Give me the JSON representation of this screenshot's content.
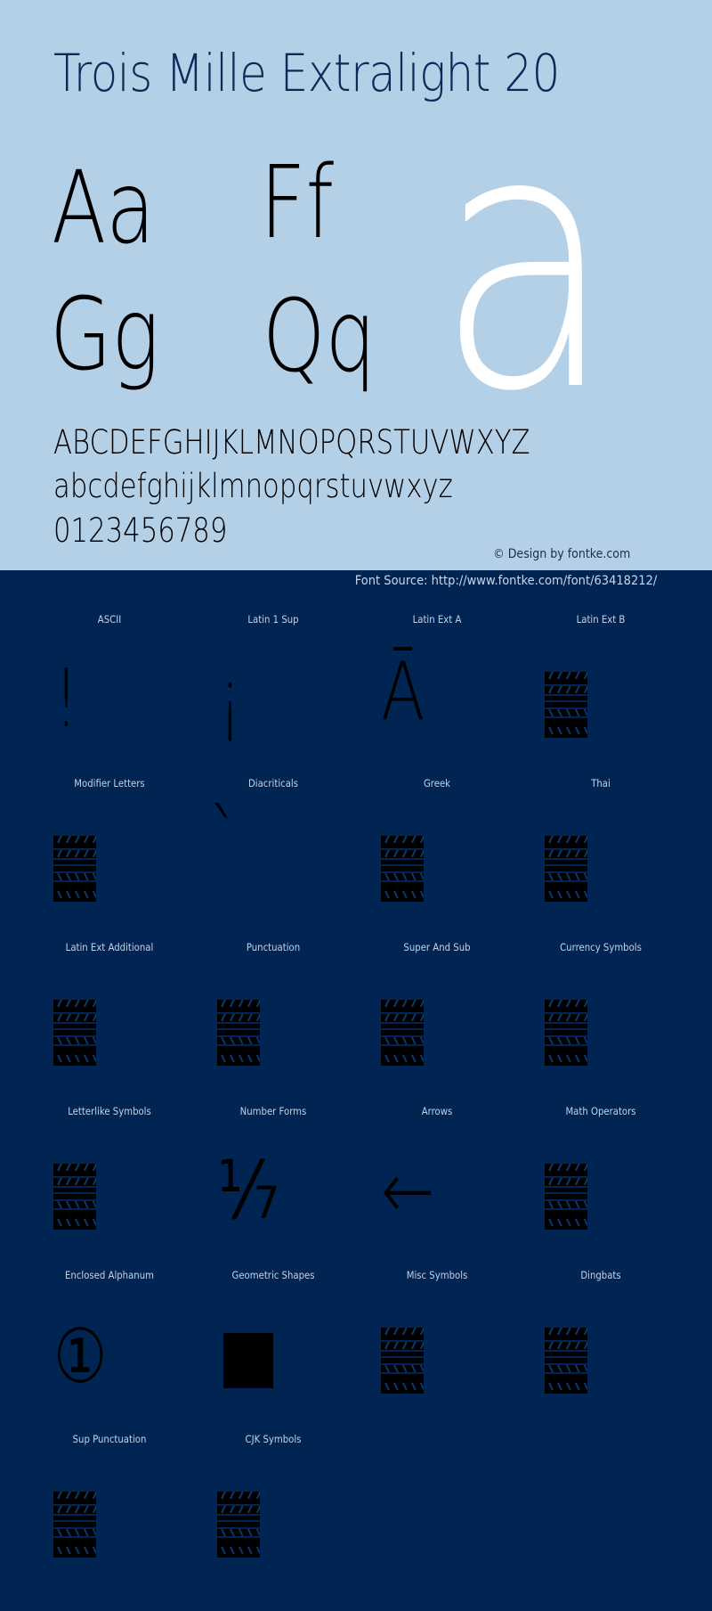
{
  "header": {
    "title": "Trois Mille Extralight 20"
  },
  "specimen": {
    "pairs": [
      "Aa",
      "Ff",
      "Gg",
      "Qq"
    ],
    "big_glyph": "a",
    "uppercase": "ABCDEFGHIJKLMNOPQRSTUVWXYZ",
    "lowercase": "abcdefghijklmnopqrstuvwxyz",
    "digits": "0123456789",
    "credit": "© Design by fontke.com",
    "source": "Font Source: http://www.fontke.com/font/63418212/"
  },
  "colors": {
    "top_background": "#b4d0e7",
    "bottom_background": "#002553",
    "title_color": "#0a2a5a",
    "big_glyph_color": "#ffffff"
  },
  "blocks": [
    {
      "label": "ASCII",
      "glyph": "!",
      "type": "glyph"
    },
    {
      "label": "Latin 1 Sup",
      "glyph": "¡",
      "type": "glyph"
    },
    {
      "label": "Latin Ext A",
      "glyph": "Ā",
      "type": "glyph"
    },
    {
      "label": "Latin Ext B",
      "glyph": "",
      "type": "missing"
    },
    {
      "label": "Modifier Letters",
      "glyph": "",
      "type": "missing"
    },
    {
      "label": "Diacriticals",
      "glyph": "`",
      "type": "glyph"
    },
    {
      "label": "Greek",
      "glyph": "",
      "type": "missing"
    },
    {
      "label": "Thai",
      "glyph": "",
      "type": "missing"
    },
    {
      "label": "Latin Ext Additional",
      "glyph": "",
      "type": "missing"
    },
    {
      "label": "Punctuation",
      "glyph": "",
      "type": "missing"
    },
    {
      "label": "Super And Sub",
      "glyph": "",
      "type": "missing"
    },
    {
      "label": "Currency Symbols",
      "glyph": "",
      "type": "missing"
    },
    {
      "label": "Letterlike Symbols",
      "glyph": "",
      "type": "missing"
    },
    {
      "label": "Number Forms",
      "glyph": "⅐",
      "type": "glyph"
    },
    {
      "label": "Arrows",
      "glyph": "←",
      "type": "glyph"
    },
    {
      "label": "Math Operators",
      "glyph": "",
      "type": "missing"
    },
    {
      "label": "Enclosed Alphanum",
      "glyph": "①",
      "type": "glyph"
    },
    {
      "label": "Geometric Shapes",
      "glyph": "■",
      "type": "square"
    },
    {
      "label": "Misc Symbols",
      "glyph": "",
      "type": "missing"
    },
    {
      "label": "Dingbats",
      "glyph": "",
      "type": "missing"
    },
    {
      "label": "Sup Punctuation",
      "glyph": "",
      "type": "missing"
    },
    {
      "label": "CJK Symbols",
      "glyph": "",
      "type": "missing"
    }
  ]
}
